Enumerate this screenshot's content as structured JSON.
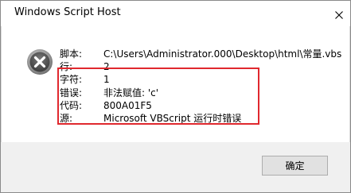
{
  "window": {
    "title": "Windows Script Host"
  },
  "fields": [
    {
      "label": "脚本:",
      "value": "C:\\Users\\Administrator.000\\Desktop\\html\\常量.vbs"
    },
    {
      "label": "行:",
      "value": "2"
    },
    {
      "label": "字符:",
      "value": "1"
    },
    {
      "label": "错误:",
      "value": "非法赋值: 'c'"
    },
    {
      "label": "代码:",
      "value": "800A01F5"
    },
    {
      "label": "源:",
      "value": "Microsoft VBScript 运行时错误"
    }
  ],
  "footer": {
    "ok_label": "确定"
  },
  "colors": {
    "error_icon_bg": "#c42b1c",
    "highlight": "#e0282e",
    "footer_bg": "#f0f0f0"
  },
  "icons": {
    "close": "close-icon",
    "error": "error-icon"
  }
}
